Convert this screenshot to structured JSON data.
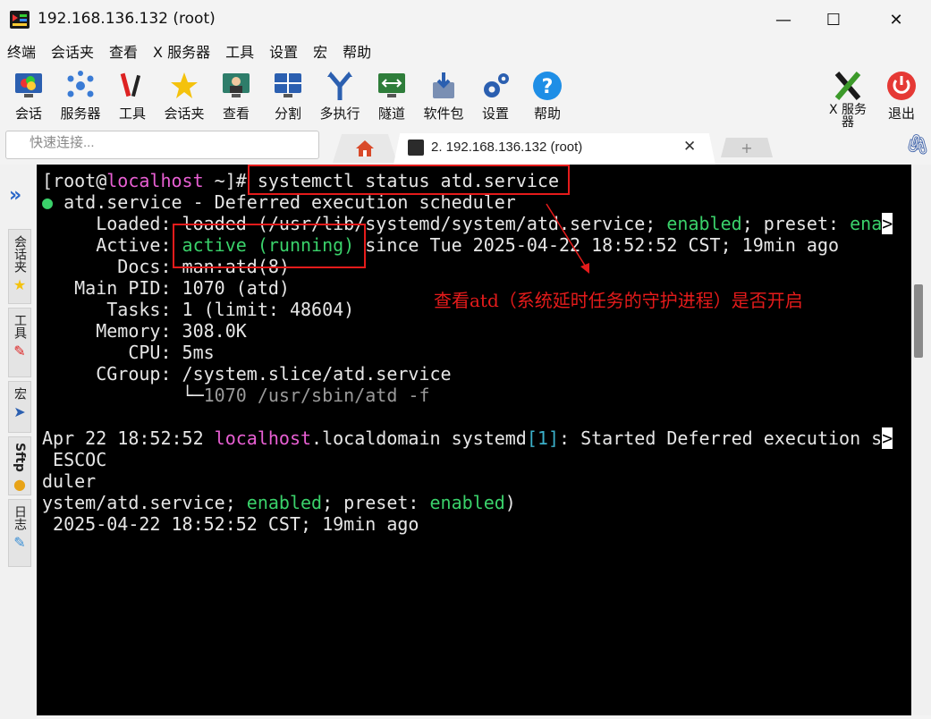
{
  "window": {
    "title": "192.168.136.132 (root)",
    "minimize": "—",
    "maximize": "☐",
    "close": "✕"
  },
  "menu": [
    "终端",
    "会话夹",
    "查看",
    "X 服务器",
    "工具",
    "设置",
    "宏",
    "帮助"
  ],
  "toolbar": {
    "session": "会话",
    "servers": "服务器",
    "tools": "工具",
    "sessions": "会话夹",
    "view": "查看",
    "split": "分割",
    "multiexec": "多执行",
    "tunneling": "隧道",
    "packages": "软件包",
    "settings": "设置",
    "help": "帮助",
    "xserver_l1": "X 服务",
    "xserver_l2": "器",
    "exit": "退出"
  },
  "quickconnect": {
    "placeholder": "快速连接..."
  },
  "tabs": {
    "active": "2. 192.168.136.132 (root)",
    "close": "✕",
    "new": "+"
  },
  "sidebar": {
    "sessions": "会话夹",
    "tools": "工具",
    "macros": "宏",
    "sftp": "Sftp",
    "log": "日志"
  },
  "terminal": {
    "prompt_open": "[root@",
    "prompt_host": "localhost",
    "prompt_close": " ~]# ",
    "command": "systemctl status atd.service",
    "l1_dot": "●",
    "l1": " atd.service - Deferred execution scheduler",
    "loaded_pre": "     Loaded: loaded (/usr/lib/systemd/system/atd.service; ",
    "loaded_enabled": "enabled",
    "loaded_mid": "; preset: ",
    "loaded_ena": "ena",
    "trunc": ">",
    "active_label": "     Active: ",
    "active_state": "active (running)",
    "active_since": " since Tue 2025-04-22 18:52:52 CST; 19min ago",
    "docs": "       Docs: man:atd(8)",
    "mainpid": "   Main PID: 1070 (atd)",
    "tasks": "      Tasks: 1 (limit: 48604)",
    "memory": "     Memory: 308.0K",
    "cpu": "        CPU: 5ms",
    "cgroup": "     CGroup: /system.slice/atd.service",
    "cgroup_tree": "             └─",
    "cgroup_proc": "1070 /usr/sbin/atd -f",
    "log_date": "Apr 22 18:52:52 ",
    "log_host": "localhost",
    "log_mid": ".localdomain systemd",
    "log_pid": "[1]",
    "log_msg": ": Started Deferred execution s",
    "escoc": " ESCOC",
    "duler": "duler",
    "ystem_pre": "ystem/atd.service; ",
    "ystem_enabled1": "enabled",
    "ystem_mid": "; preset: ",
    "ystem_enabled2": "enabled",
    "ystem_end": ")",
    "since": " 2025-04-22 18:52:52 CST; 19min ago"
  },
  "annotation": "查看atd（系统延时任务的守护进程）是否开启",
  "colors": {
    "highlight": "#e51b1b",
    "terminal_bg": "#000000",
    "host": "#e85fd3",
    "enabled": "#3ad16a"
  }
}
